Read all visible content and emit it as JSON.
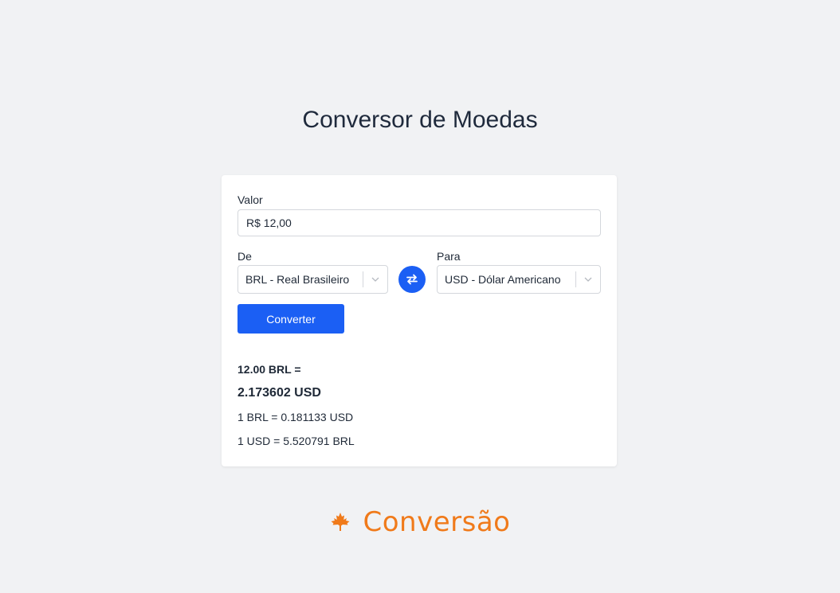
{
  "page": {
    "title": "Conversor de Moedas"
  },
  "form": {
    "valor_label": "Valor",
    "valor_value": "R$ 12,00",
    "de_label": "De",
    "de_value": "BRL - Real Brasileiro",
    "para_label": "Para",
    "para_value": "USD - Dólar Americano",
    "convert_label": "Converter"
  },
  "result": {
    "line1": "12.00 BRL =",
    "line2": "2.173602 USD",
    "rate1": "1 BRL = 0.181133 USD",
    "rate2": "1 USD = 5.520791 BRL"
  },
  "footer": {
    "brand": "Conversão",
    "icon": "maple-leaf-icon"
  },
  "colors": {
    "accent": "#1b5ff4",
    "brand": "#f07a1a",
    "background": "#f1f2f4"
  }
}
